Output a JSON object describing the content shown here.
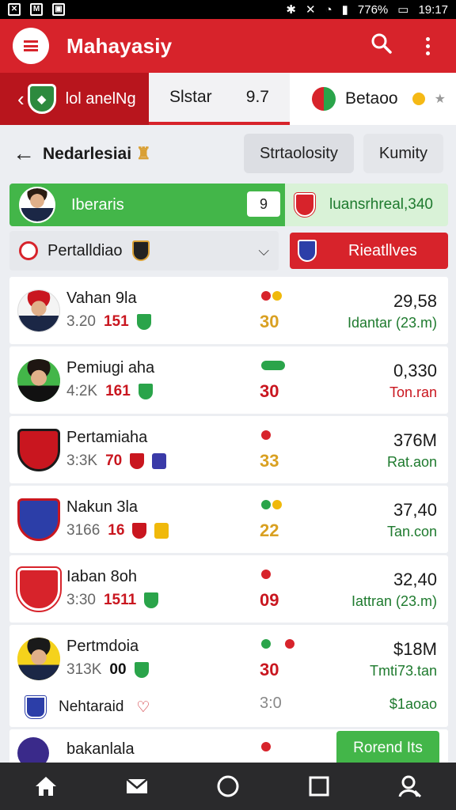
{
  "status": {
    "battery": "776%",
    "time": "19:17"
  },
  "appbar": {
    "title": "Mahayasiy"
  },
  "matchbar": {
    "left_team": "lol anelNg",
    "center_label": "Slstar",
    "center_value": "9.7",
    "right_team": "Betaoo"
  },
  "subheader": {
    "title": "Nedarlesiai",
    "chip_a": "Strtaolosity",
    "chip_b": "Kumity"
  },
  "highlight": {
    "name": "Iberaris",
    "number": "9",
    "right_text": "luansrhreal,340"
  },
  "filter": {
    "select_label": "Pertalldiao",
    "button_label": "Rieatllves"
  },
  "rows": [
    {
      "name": "Vahan 9la",
      "stat1": "3.20",
      "stat2": "151",
      "score": "30",
      "value": "29,58",
      "detail": "Idantar (23.m)",
      "score_color": "#d9a021",
      "detail_color": "#1e7a2e",
      "dots": [
        "#d7232b",
        "#f0b90b"
      ]
    },
    {
      "name": "Pemiugi aha",
      "stat1": "4:2K",
      "stat2": "161",
      "score": "30",
      "value": "0,330",
      "detail": "Ton.ran",
      "score_color": "#c9161f",
      "detail_color": "#c9161f",
      "dots": [
        "#2aa44a"
      ]
    },
    {
      "name": "Pertamiaha",
      "stat1": "3:3K",
      "stat2": "70",
      "score": "33",
      "value": "376M",
      "detail": "Rat.aon",
      "score_color": "#d9a021",
      "detail_color": "#1e7a2e",
      "dots": [
        "#d7232b"
      ]
    },
    {
      "name": "Nakun 3la",
      "stat1": "3166",
      "stat2": "16",
      "score": "22",
      "value": "37,40",
      "detail": "Tan.con",
      "score_color": "#d9a021",
      "detail_color": "#1e7a2e",
      "dots": [
        "#2aa44a",
        "#f0b90b"
      ]
    },
    {
      "name": "Iaban 8oh",
      "stat1": "3:30",
      "stat2": "1511",
      "score": "09",
      "value": "32,40",
      "detail": "Iattran (23.m)",
      "score_color": "#c9161f",
      "detail_color": "#1e7a2e",
      "dots": [
        "#d7232b"
      ]
    },
    {
      "name": "Pertmdoia",
      "stat1": "313K",
      "stat2": "00",
      "score": "30",
      "value": "$18M",
      "detail": "Tmti73.tan",
      "score_color": "#c9161f",
      "detail_color": "#1e7a2e",
      "dots": [
        "#2aa44a",
        "#d7232b"
      ],
      "extra_name": "Nehtaraid",
      "extra_score": "3:0",
      "extra_value": "$1aoao"
    },
    {
      "name": "bakanlala",
      "dots": [
        "#d7232b"
      ]
    }
  ],
  "float_button": "Rorend Its"
}
